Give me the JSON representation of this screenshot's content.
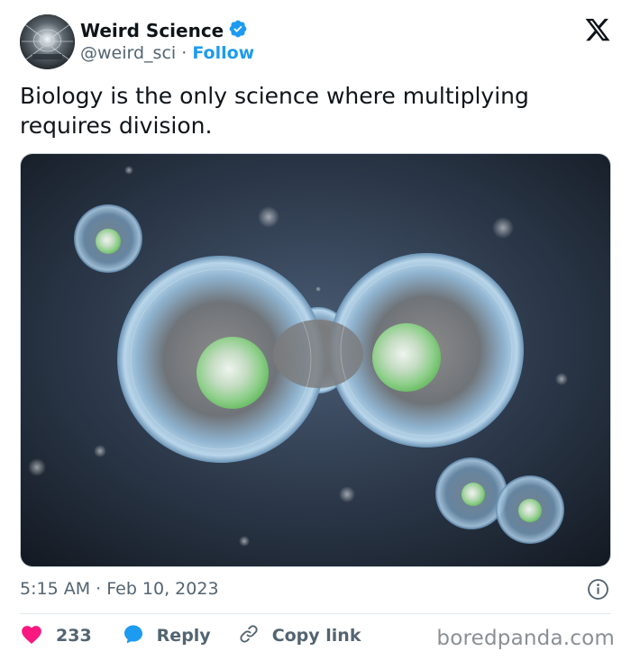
{
  "author": {
    "name": "Weird Science",
    "handle": "@weird_sci",
    "separator": "·",
    "follow_label": "Follow",
    "verified_color": "#1d9bf0"
  },
  "platform_icon": "x-logo-icon",
  "tweet": {
    "text": "Biology is the only science where multiplying requires division.",
    "media_description_icon": "dividing-cell-image"
  },
  "meta": {
    "time": "5:15 AM",
    "separator": "·",
    "date": "Feb 10, 2023"
  },
  "actions": {
    "like_count": "233",
    "reply_label": "Reply",
    "copy_label": "Copy link",
    "like_color": "#f91880",
    "reply_color": "#1d9bf0"
  },
  "watermark": "boredpanda.com"
}
